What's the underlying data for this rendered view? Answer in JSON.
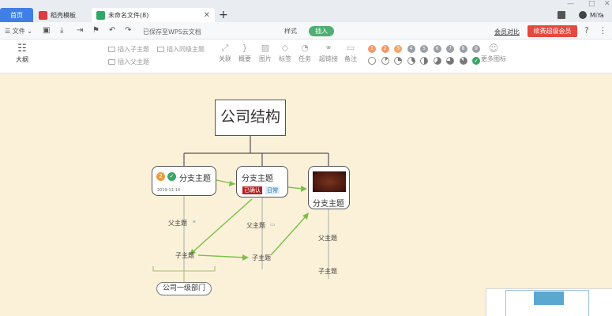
{
  "titlebar": {
    "tabs": [
      {
        "label": "首页"
      },
      {
        "label": "稻壳模板"
      },
      {
        "label": "未命名文件(8)"
      }
    ],
    "user": "MiYa",
    "colors": {
      "home_tab": "#3f7fe6",
      "tpl_icon": "#e0393e",
      "doc_icon": "#2fa86a"
    }
  },
  "toolbar": {
    "file_menu": "文件",
    "saved_status": "已保存至WPS云文档",
    "mode_style": "样式",
    "mode_insert": "插入",
    "member_compare": "会员对比",
    "buy_button": "续费超级会员"
  },
  "ribbon": {
    "outline": "大纲",
    "insert_child": "插入子主题",
    "insert_sibling": "插入同级主题",
    "insert_parent": "插入父主题",
    "tools": [
      {
        "label": "关联",
        "icon": "relation-icon"
      },
      {
        "label": "概要",
        "icon": "summary-icon"
      },
      {
        "label": "图片",
        "icon": "image-icon"
      },
      {
        "label": "标签",
        "icon": "tag-icon"
      },
      {
        "label": "任务",
        "icon": "task-icon"
      },
      {
        "label": "超链接",
        "icon": "link-icon"
      },
      {
        "label": "备注",
        "icon": "note-icon"
      }
    ],
    "priorities": [
      "1",
      "2",
      "3",
      "4",
      "5",
      "6",
      "7",
      "8",
      "9"
    ],
    "progress": [
      0,
      0.125,
      0.25,
      0.375,
      0.5,
      0.625,
      0.75,
      0.875,
      1
    ],
    "more_icons": "更多图标"
  },
  "mindmap": {
    "root": "公司结构",
    "branch1": {
      "label": "分支主题",
      "priority": "2",
      "date": "2019-11-14 - "
    },
    "branch2": {
      "label": "分支主题",
      "tag_confirmed": "已确认",
      "tag_daily": "日常"
    },
    "branch3": {
      "label": "分支主题"
    },
    "parent1": "父主题",
    "child1": "子主题",
    "parent2": "父主题",
    "child2": "子主题",
    "parent3": "父主题",
    "child3": "子主题",
    "summary": "公司一级部门"
  }
}
